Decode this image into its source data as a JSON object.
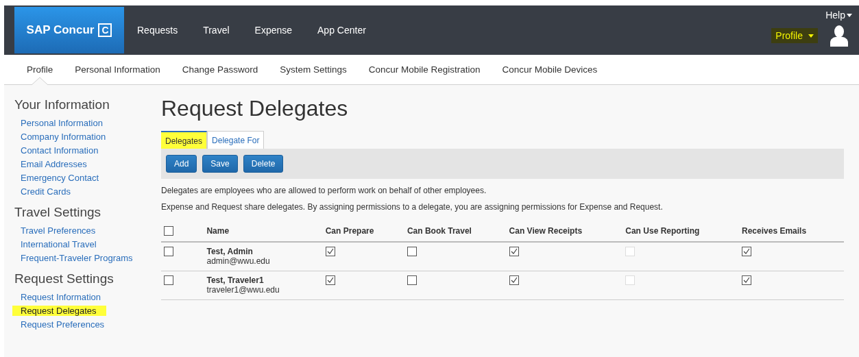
{
  "header": {
    "logo": "SAP Concur",
    "logo_mark": "C",
    "nav": [
      "Requests",
      "Travel",
      "Expense",
      "App Center"
    ],
    "help": "Help",
    "profile": {
      "label": "Profile",
      "highlighted": true
    }
  },
  "subnav": [
    {
      "label": "Profile",
      "selected": true
    },
    {
      "label": "Personal Information",
      "selected": false
    },
    {
      "label": "Change Password",
      "selected": false
    },
    {
      "label": "System Settings",
      "selected": false
    },
    {
      "label": "Concur Mobile Registration",
      "selected": false
    },
    {
      "label": "Concur Mobile Devices",
      "selected": false
    }
  ],
  "sidebar": [
    {
      "heading": "Your Information",
      "items": [
        {
          "label": "Personal Information",
          "selected": false
        },
        {
          "label": "Company Information",
          "selected": false
        },
        {
          "label": "Contact Information",
          "selected": false
        },
        {
          "label": "Email Addresses",
          "selected": false
        },
        {
          "label": "Emergency Contact",
          "selected": false
        },
        {
          "label": "Credit Cards",
          "selected": false
        }
      ]
    },
    {
      "heading": "Travel Settings",
      "items": [
        {
          "label": "Travel Preferences",
          "selected": false
        },
        {
          "label": "International Travel",
          "selected": false
        },
        {
          "label": "Frequent-Traveler Programs",
          "selected": false
        }
      ]
    },
    {
      "heading": "Request Settings",
      "items": [
        {
          "label": "Request Information",
          "selected": false
        },
        {
          "label": "Request Delegates",
          "selected": true
        },
        {
          "label": "Request Preferences",
          "selected": false
        }
      ]
    }
  ],
  "page_title": "Request Delegates",
  "tabs": [
    {
      "label": "Delegates",
      "selected": true
    },
    {
      "label": "Delegate For",
      "selected": false
    }
  ],
  "buttons": [
    "Add",
    "Save",
    "Delete"
  ],
  "notes": [
    "Delegates are employees who are allowed to perform work on behalf of other employees.",
    "Expense and Request share delegates. By assigning permissions to a delegate, you are assigning permissions for Expense and Request."
  ],
  "table": {
    "select_all": {
      "checked": false
    },
    "columns": [
      "Name",
      "Can Prepare",
      "Can Book Travel",
      "Can View Receipts",
      "Can Use Reporting",
      "Receives Emails"
    ],
    "rows": [
      {
        "selected": false,
        "name": "Test, Admin",
        "email": "admin@wwu.edu",
        "permissions": [
          {
            "checked": true,
            "disabled": false
          },
          {
            "checked": false,
            "disabled": false
          },
          {
            "checked": true,
            "disabled": false
          },
          {
            "checked": false,
            "disabled": true
          },
          {
            "checked": true,
            "disabled": false
          }
        ]
      },
      {
        "selected": false,
        "name": "Test, Traveler1",
        "email": "traveler1@wwu.edu",
        "permissions": [
          {
            "checked": true,
            "disabled": false
          },
          {
            "checked": false,
            "disabled": false
          },
          {
            "checked": true,
            "disabled": false
          },
          {
            "checked": false,
            "disabled": true
          },
          {
            "checked": true,
            "disabled": false
          }
        ]
      }
    ]
  }
}
